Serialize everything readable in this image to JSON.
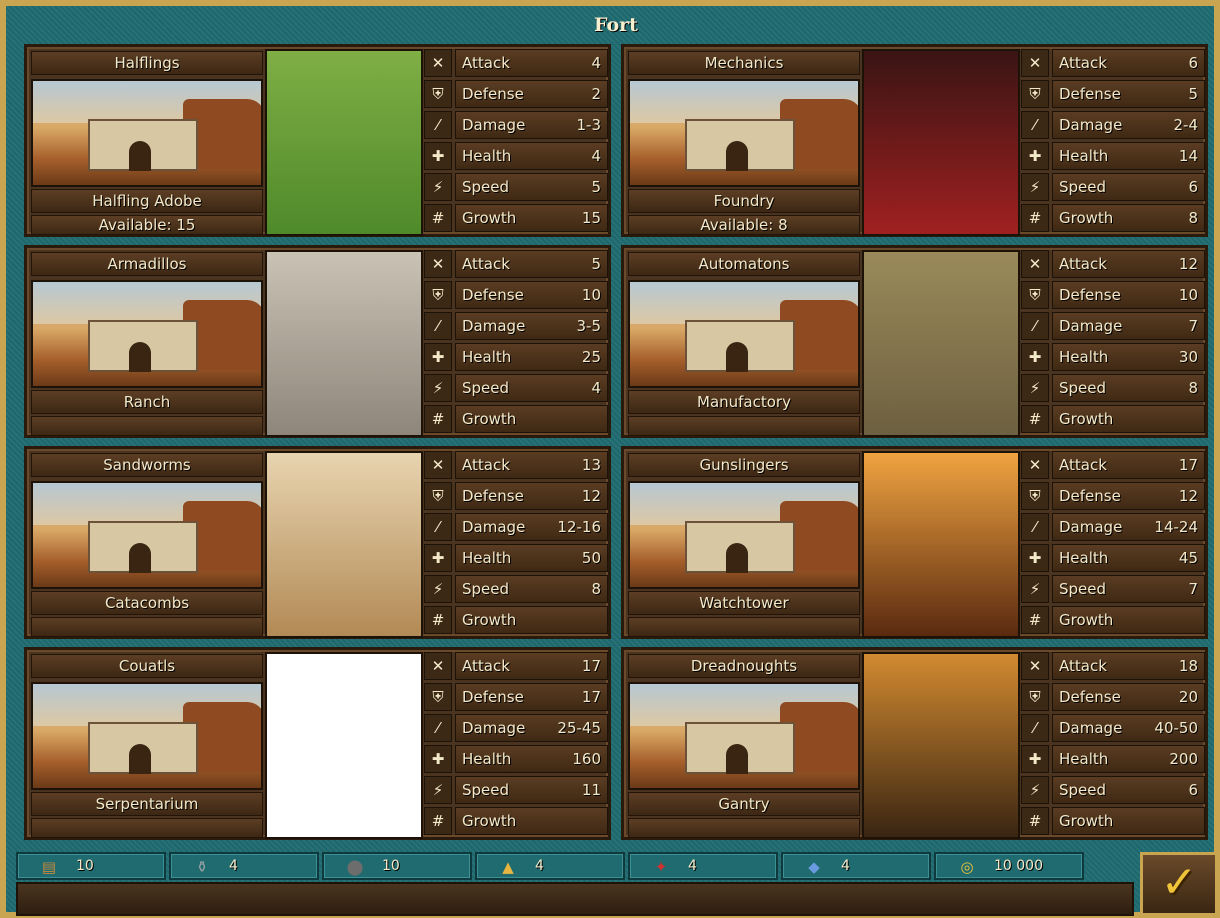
{
  "title": "Fort",
  "stat_labels": {
    "attack": "Attack",
    "defense": "Defense",
    "damage": "Damage",
    "health": "Health",
    "speed": "Speed",
    "growth": "Growth"
  },
  "creatures": [
    {
      "name": "Halflings",
      "building": "Halfling Adobe",
      "available": "Available:  15",
      "attack": "4",
      "defense": "2",
      "damage": "1-3",
      "health": "4",
      "speed": "5",
      "growth": "15"
    },
    {
      "name": "Mechanics",
      "building": "Foundry",
      "available": "Available:  8",
      "attack": "6",
      "defense": "5",
      "damage": "2-4",
      "health": "14",
      "speed": "6",
      "growth": "8"
    },
    {
      "name": "Armadillos",
      "building": "Ranch",
      "available": "",
      "attack": "5",
      "defense": "10",
      "damage": "3-5",
      "health": "25",
      "speed": "4",
      "growth": ""
    },
    {
      "name": "Automatons",
      "building": "Manufactory",
      "available": "",
      "attack": "12",
      "defense": "10",
      "damage": "7",
      "health": "30",
      "speed": "8",
      "growth": ""
    },
    {
      "name": "Sandworms",
      "building": "Catacombs",
      "available": "",
      "attack": "13",
      "defense": "12",
      "damage": "12-16",
      "health": "50",
      "speed": "8",
      "growth": ""
    },
    {
      "name": "Gunslingers",
      "building": "Watchtower",
      "available": "",
      "attack": "17",
      "defense": "12",
      "damage": "14-24",
      "health": "45",
      "speed": "7",
      "growth": ""
    },
    {
      "name": "Couatls",
      "building": "Serpentarium",
      "available": "",
      "attack": "17",
      "defense": "17",
      "damage": "25-45",
      "health": "160",
      "speed": "11",
      "growth": ""
    },
    {
      "name": "Dreadnoughts",
      "building": "Gantry",
      "available": "",
      "attack": "18",
      "defense": "20",
      "damage": "40-50",
      "health": "200",
      "speed": "6",
      "growth": ""
    }
  ],
  "resources": [
    {
      "icon": "wood-icon",
      "value": "10"
    },
    {
      "icon": "mercury-icon",
      "value": "4"
    },
    {
      "icon": "ore-icon",
      "value": "10"
    },
    {
      "icon": "sulfur-icon",
      "value": "4"
    },
    {
      "icon": "crystal-icon",
      "value": "4"
    },
    {
      "icon": "gems-icon",
      "value": "4"
    },
    {
      "icon": "gold-icon",
      "value": "10 000"
    }
  ],
  "colors": {
    "frame_teal": "#1f6b70",
    "panel_brown": "#4a3420",
    "gold_border": "#c9a551",
    "text_cream": "#f3e9c9"
  }
}
